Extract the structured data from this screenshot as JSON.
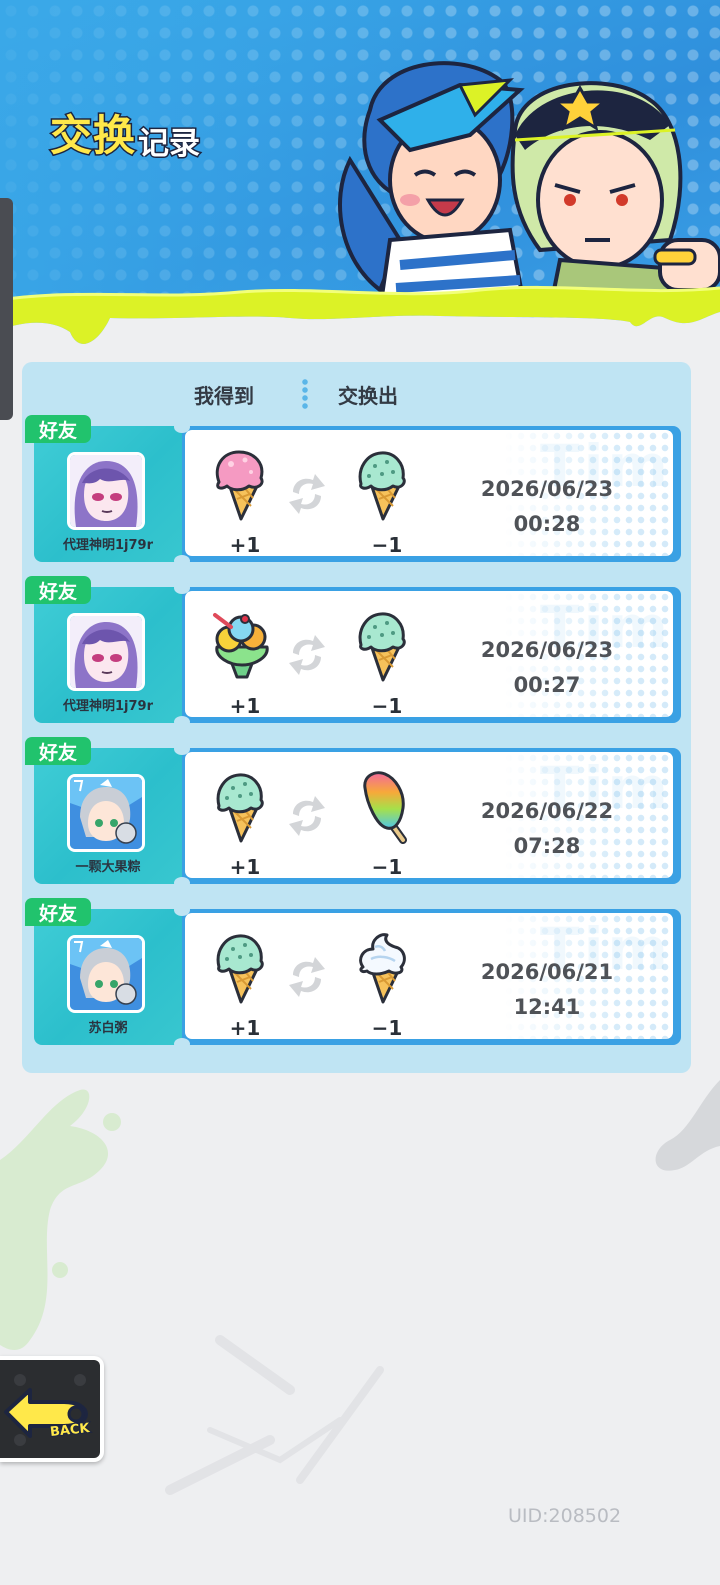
{
  "header": {
    "title_main": "交换",
    "title_sub": "记录"
  },
  "columns": {
    "received": "我得到",
    "given": "交换出"
  },
  "records": [
    {
      "badge": "好友",
      "name": "代理神明1j79r",
      "received_item": "strawberry-ice-cream-cone-icon",
      "received_qty": "+1",
      "given_item": "mint-ice-cream-cone-icon",
      "given_qty": "−1",
      "date": "2026/06/23",
      "time": "00:28"
    },
    {
      "badge": "好友",
      "name": "代理神明1j79r",
      "received_item": "fruit-sundae-cup-icon",
      "received_qty": "+1",
      "given_item": "mint-ice-cream-cone-icon",
      "given_qty": "−1",
      "date": "2026/06/23",
      "time": "00:27"
    },
    {
      "badge": "好友",
      "name": "一颗大果粽",
      "received_item": "mint-ice-cream-cone-icon",
      "received_qty": "+1",
      "given_item": "rainbow-popsicle-icon",
      "given_qty": "−1",
      "date": "2026/06/22",
      "time": "07:28"
    },
    {
      "badge": "好友",
      "name": "苏白粥",
      "received_item": "mint-ice-cream-cone-icon",
      "received_qty": "+1",
      "given_item": "vanilla-soft-serve-cone-icon",
      "given_qty": "−1",
      "date": "2026/06/21",
      "time": "12:41"
    }
  ],
  "footer": {
    "back_label": "BACK",
    "uid": "UID:208502"
  },
  "colors": {
    "header_blue": "#3aa8e8",
    "slime_green": "#dcf226",
    "panel_blue": "#bfe4f3",
    "badge_green": "#21c36d",
    "card_blue": "#3aa1e4"
  }
}
